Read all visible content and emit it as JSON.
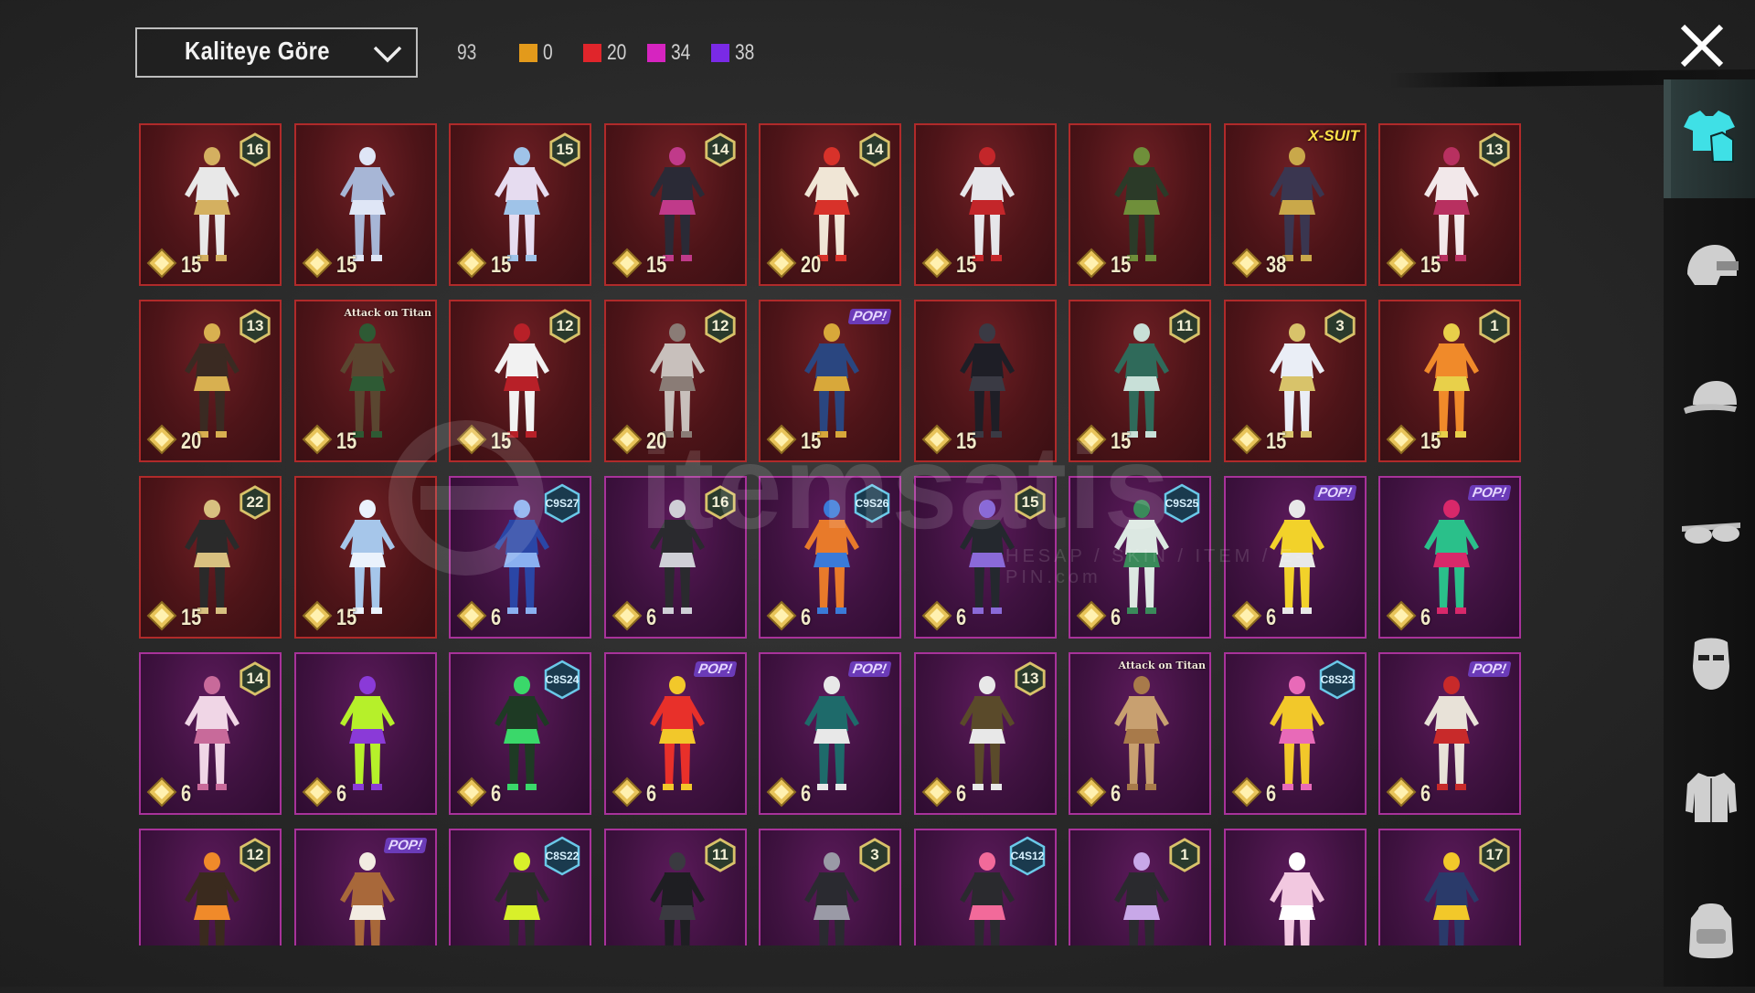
{
  "header": {
    "sort_dropdown_label": "Kaliteye Göre",
    "total_count": "93",
    "quality_counts": [
      {
        "color": "#e39a1b",
        "value": "0"
      },
      {
        "color": "#e0252b",
        "value": "20"
      },
      {
        "color": "#d624c0",
        "value": "34"
      },
      {
        "color": "#7a2ae6",
        "value": "38"
      }
    ]
  },
  "sidebar": {
    "categories": [
      {
        "icon": "outfit-icon",
        "active": true
      },
      {
        "icon": "helmet-icon",
        "active": false
      },
      {
        "icon": "cap-icon",
        "active": false
      },
      {
        "icon": "glasses-icon",
        "active": false
      },
      {
        "icon": "mask-icon",
        "active": false
      },
      {
        "icon": "jacket-icon",
        "active": false
      },
      {
        "icon": "backpack-icon",
        "active": false
      }
    ]
  },
  "watermark": {
    "text": "itemsatis",
    "subtitle": "HESAP / SKIN / ITEM / E-PIN.com"
  },
  "items": [
    {
      "rarity": "red",
      "badge": "16",
      "price": "15",
      "body": "#e8e8e8",
      "accent": "#d4b060"
    },
    {
      "rarity": "red",
      "badge": "",
      "price": "15",
      "body": "#a7b6d6",
      "accent": "#dfe6f6"
    },
    {
      "rarity": "red",
      "badge": "15",
      "price": "15",
      "body": "#e6dcf0",
      "accent": "#9fc3e8"
    },
    {
      "rarity": "red",
      "badge": "14",
      "price": "15",
      "body": "#2a2a36",
      "accent": "#c03a8a"
    },
    {
      "rarity": "red",
      "badge": "14",
      "price": "20",
      "body": "#f0e6d6",
      "accent": "#d8322a"
    },
    {
      "rarity": "red",
      "badge": "",
      "price": "15",
      "body": "#e6e6ea",
      "accent": "#c3262a"
    },
    {
      "rarity": "red",
      "badge": "",
      "price": "15",
      "body": "#2b3a28",
      "accent": "#6f8f3a"
    },
    {
      "rarity": "red",
      "badge": "",
      "tag": "X-SUIT",
      "price": "38",
      "body": "#3a3650",
      "accent": "#c9a84a"
    },
    {
      "rarity": "red",
      "badge": "13",
      "price": "15",
      "body": "#f2e8ea",
      "accent": "#b83060"
    },
    {
      "rarity": "red",
      "badge": "13",
      "price": "20",
      "body": "#3a2a22",
      "accent": "#d8b050"
    },
    {
      "rarity": "red",
      "badge": "",
      "collab": "Attack on Titan",
      "price": "15",
      "body": "#5a4630",
      "accent": "#2e5a34"
    },
    {
      "rarity": "red",
      "badge": "12",
      "price": "15",
      "body": "#f2f2f2",
      "accent": "#b82028"
    },
    {
      "rarity": "red",
      "badge": "12",
      "price": "20",
      "body": "#c8c0bc",
      "accent": "#8a7c76"
    },
    {
      "rarity": "red",
      "badge": "",
      "pop": "POP!",
      "price": "15",
      "body": "#2a4680",
      "accent": "#d8a83a"
    },
    {
      "rarity": "red",
      "badge": "",
      "price": "15",
      "body": "#1e1e26",
      "accent": "#3a3a44"
    },
    {
      "rarity": "red",
      "badge": "11",
      "price": "15",
      "body": "#2f6a5a",
      "accent": "#c8e0d8"
    },
    {
      "rarity": "red",
      "badge": "3",
      "price": "15",
      "body": "#eaeef6",
      "accent": "#d8c36a"
    },
    {
      "rarity": "red",
      "badge": "1",
      "price": "15",
      "body": "#f08a2a",
      "accent": "#e8d04a"
    },
    {
      "rarity": "red",
      "badge": "22",
      "price": "15",
      "body": "#2a2a2a",
      "accent": "#d8c080"
    },
    {
      "rarity": "red",
      "badge": "",
      "price": "15",
      "body": "#a6c6ea",
      "accent": "#eaf2fc"
    },
    {
      "rarity": "purple",
      "season": "C9S27",
      "price": "6",
      "body": "#2a46a6",
      "accent": "#8ab0f0"
    },
    {
      "rarity": "purple",
      "badge": "16",
      "price": "6",
      "body": "#2a2a2e",
      "accent": "#cfcfd6"
    },
    {
      "rarity": "purple",
      "season": "C9S26",
      "price": "6",
      "body": "#e87a2a",
      "accent": "#3a7ad8"
    },
    {
      "rarity": "purple",
      "badge": "15",
      "price": "6",
      "body": "#24282e",
      "accent": "#8a6ad8"
    },
    {
      "rarity": "purple",
      "season": "C9S25",
      "price": "6",
      "body": "#dce8e2",
      "accent": "#3a8a5a"
    },
    {
      "rarity": "purple",
      "pop": "POP!",
      "price": "6",
      "body": "#f2d22a",
      "accent": "#e8e8e8"
    },
    {
      "rarity": "purple",
      "pop": "POP!",
      "price": "6",
      "body": "#2ac08a",
      "accent": "#d8286a"
    },
    {
      "rarity": "purple",
      "badge": "14",
      "price": "6",
      "body": "#f0d6e6",
      "accent": "#c86a9a"
    },
    {
      "rarity": "purple",
      "badge": "",
      "price": "6",
      "body": "#b6f02a",
      "accent": "#8a3ad8"
    },
    {
      "rarity": "purple",
      "season": "C8S24",
      "price": "6",
      "body": "#1e3a24",
      "accent": "#3ad86a"
    },
    {
      "rarity": "purple",
      "pop": "POP!",
      "price": "6",
      "body": "#e8302a",
      "accent": "#f2c82a"
    },
    {
      "rarity": "purple",
      "pop": "POP!",
      "price": "6",
      "body": "#1e6a6a",
      "accent": "#e8e8e8"
    },
    {
      "rarity": "purple",
      "badge": "13",
      "price": "6",
      "body": "#5a4a2a",
      "accent": "#e8e8e8"
    },
    {
      "rarity": "purple",
      "collab": "Attack on Titan",
      "price": "6",
      "body": "#c8a070",
      "accent": "#a87a4a"
    },
    {
      "rarity": "purple",
      "season": "C8S23",
      "price": "6",
      "body": "#f2c82a",
      "accent": "#e86ab8"
    },
    {
      "rarity": "purple",
      "pop": "POP!",
      "price": "6",
      "body": "#e8e2d8",
      "accent": "#c82a2a"
    },
    {
      "rarity": "purple",
      "badge": "12",
      "price": "",
      "body": "#3a2a1e",
      "accent": "#f08a2a"
    },
    {
      "rarity": "purple",
      "pop": "POP!",
      "price": "",
      "body": "#a8683a",
      "accent": "#f2ece2"
    },
    {
      "rarity": "purple",
      "season": "C8S22",
      "price": "",
      "body": "#2a2a2a",
      "accent": "#d8f02a"
    },
    {
      "rarity": "purple",
      "badge": "11",
      "price": "",
      "body": "#1e1e22",
      "accent": "#3a3a40"
    },
    {
      "rarity": "purple",
      "badge": "3",
      "price": "",
      "body": "#2a2a30",
      "accent": "#9a9aa6"
    },
    {
      "rarity": "purple",
      "season": "C4S12",
      "price": "",
      "body": "#2a2a2e",
      "accent": "#f26a9a"
    },
    {
      "rarity": "purple",
      "badge": "1",
      "price": "",
      "body": "#2a2a2e",
      "accent": "#c8a8e8"
    },
    {
      "rarity": "purple",
      "badge": "",
      "price": "",
      "body": "#f2c8e0",
      "accent": "#ffffff"
    },
    {
      "rarity": "purple",
      "badge": "17",
      "price": "",
      "body": "#2a3a6a",
      "accent": "#f2c82a"
    }
  ]
}
